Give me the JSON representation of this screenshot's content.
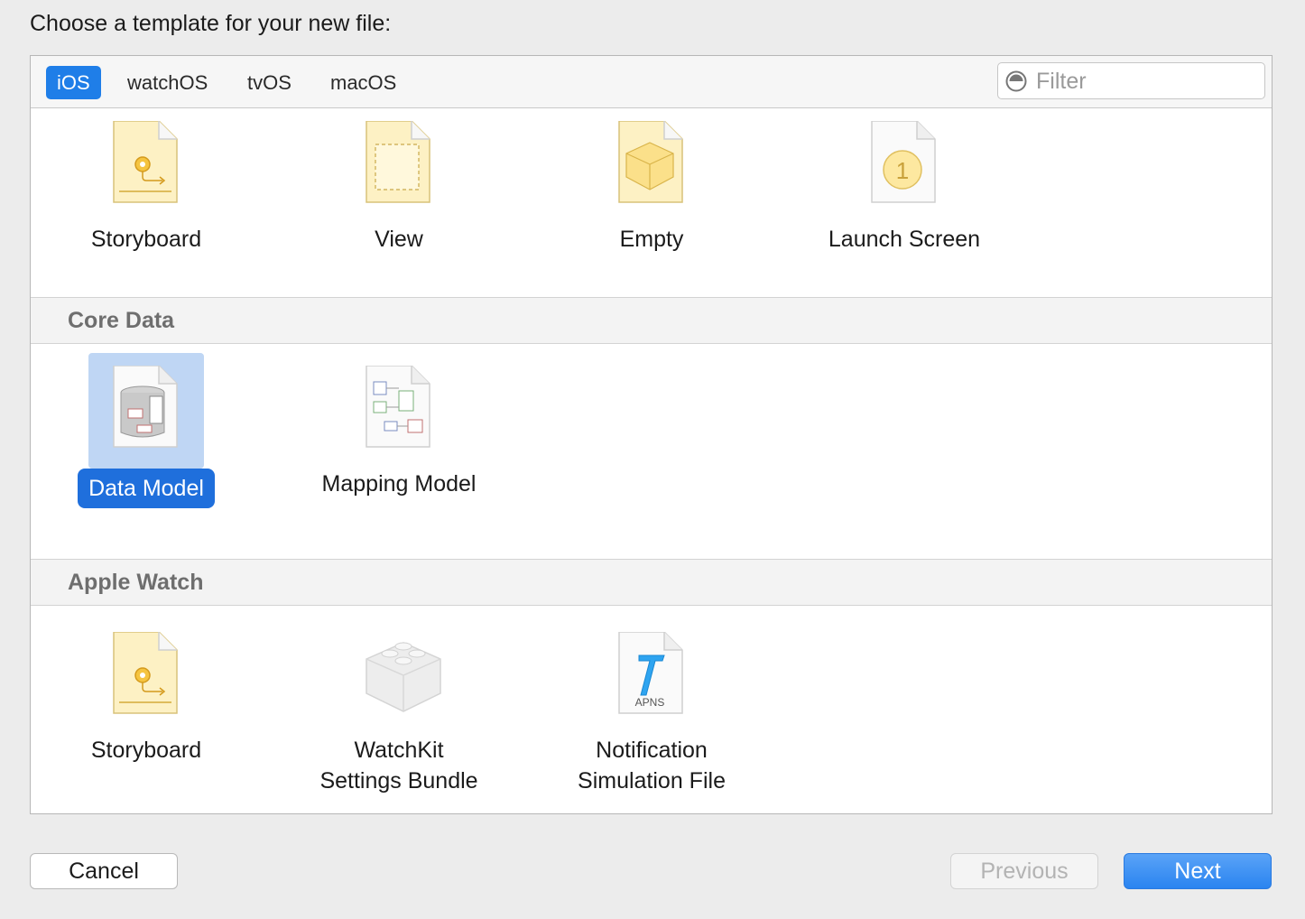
{
  "dialog": {
    "heading": "Choose a template for your new file:"
  },
  "tabs": [
    {
      "label": "iOS",
      "active": true
    },
    {
      "label": "watchOS",
      "active": false
    },
    {
      "label": "tvOS",
      "active": false
    },
    {
      "label": "macOS",
      "active": false
    }
  ],
  "filter": {
    "placeholder": "Filter",
    "value": ""
  },
  "sections": {
    "user_interface": {
      "items": [
        {
          "label": "Storyboard",
          "icon": "storyboard-icon"
        },
        {
          "label": "View",
          "icon": "view-file-icon"
        },
        {
          "label": "Empty",
          "icon": "empty-file-icon"
        },
        {
          "label": "Launch Screen",
          "icon": "launch-screen-icon",
          "badge": "1"
        }
      ]
    },
    "core_data": {
      "title": "Core Data",
      "items": [
        {
          "label": "Data Model",
          "icon": "data-model-icon",
          "selected": true
        },
        {
          "label": "Mapping Model",
          "icon": "mapping-model-icon"
        }
      ]
    },
    "apple_watch": {
      "title": "Apple Watch",
      "items": [
        {
          "label": "Storyboard",
          "icon": "storyboard-icon"
        },
        {
          "label": "WatchKit\nSettings Bundle",
          "icon": "settings-bundle-icon"
        },
        {
          "label": "Notification\nSimulation File",
          "icon": "apns-file-icon",
          "badge": "APNS"
        }
      ]
    }
  },
  "buttons": {
    "cancel": "Cancel",
    "previous": "Previous",
    "next": "Next"
  },
  "colors": {
    "accent": "#1f7ee8",
    "selection_bg": "#bfd6f4",
    "selection_label": "#1f6fdc"
  }
}
